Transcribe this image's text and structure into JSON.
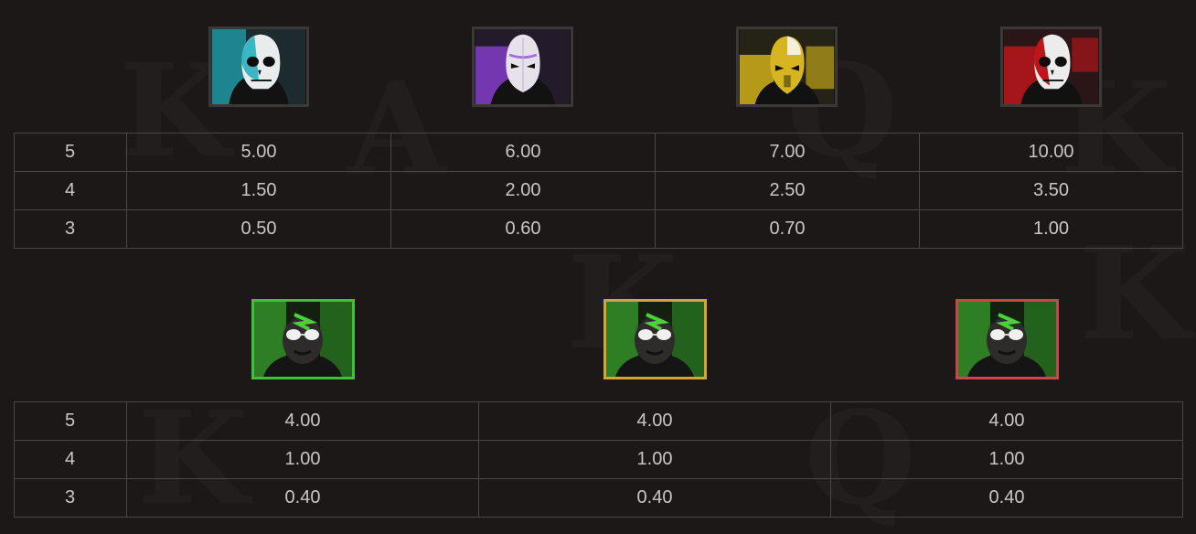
{
  "colors": {
    "background": "#1b1817",
    "grid_line": "#4a4746",
    "text": "#c9c6c4",
    "cyan_mask": "#2bb3c0",
    "purple_mask": "#8a3fd1",
    "yellow_mask": "#d9b81c",
    "red_mask": "#c4161c",
    "boss_green_frame": "#3fbf3a",
    "boss_gold_frame": "#d4a437",
    "boss_red_frame": "#c9464b"
  },
  "mask_symbols": [
    {
      "icon": "cyan-skull-mask-icon"
    },
    {
      "icon": "purple-mask-icon"
    },
    {
      "icon": "yellow-mask-icon"
    },
    {
      "icon": "red-skull-mask-icon"
    }
  ],
  "mask_table": {
    "rows": [
      {
        "count": "5",
        "values": [
          "5.00",
          "6.00",
          "7.00",
          "10.00"
        ]
      },
      {
        "count": "4",
        "values": [
          "1.50",
          "2.00",
          "2.50",
          "3.50"
        ]
      },
      {
        "count": "3",
        "values": [
          "0.50",
          "0.60",
          "0.70",
          "1.00"
        ]
      }
    ]
  },
  "boss_symbols": [
    {
      "icon": "boss-green-frame-icon"
    },
    {
      "icon": "boss-gold-frame-icon"
    },
    {
      "icon": "boss-red-frame-icon"
    }
  ],
  "boss_table": {
    "rows": [
      {
        "count": "5",
        "values": [
          "4.00",
          "4.00",
          "4.00"
        ]
      },
      {
        "count": "4",
        "values": [
          "1.00",
          "1.00",
          "1.00"
        ]
      },
      {
        "count": "3",
        "values": [
          "0.40",
          "0.40",
          "0.40"
        ]
      }
    ]
  }
}
